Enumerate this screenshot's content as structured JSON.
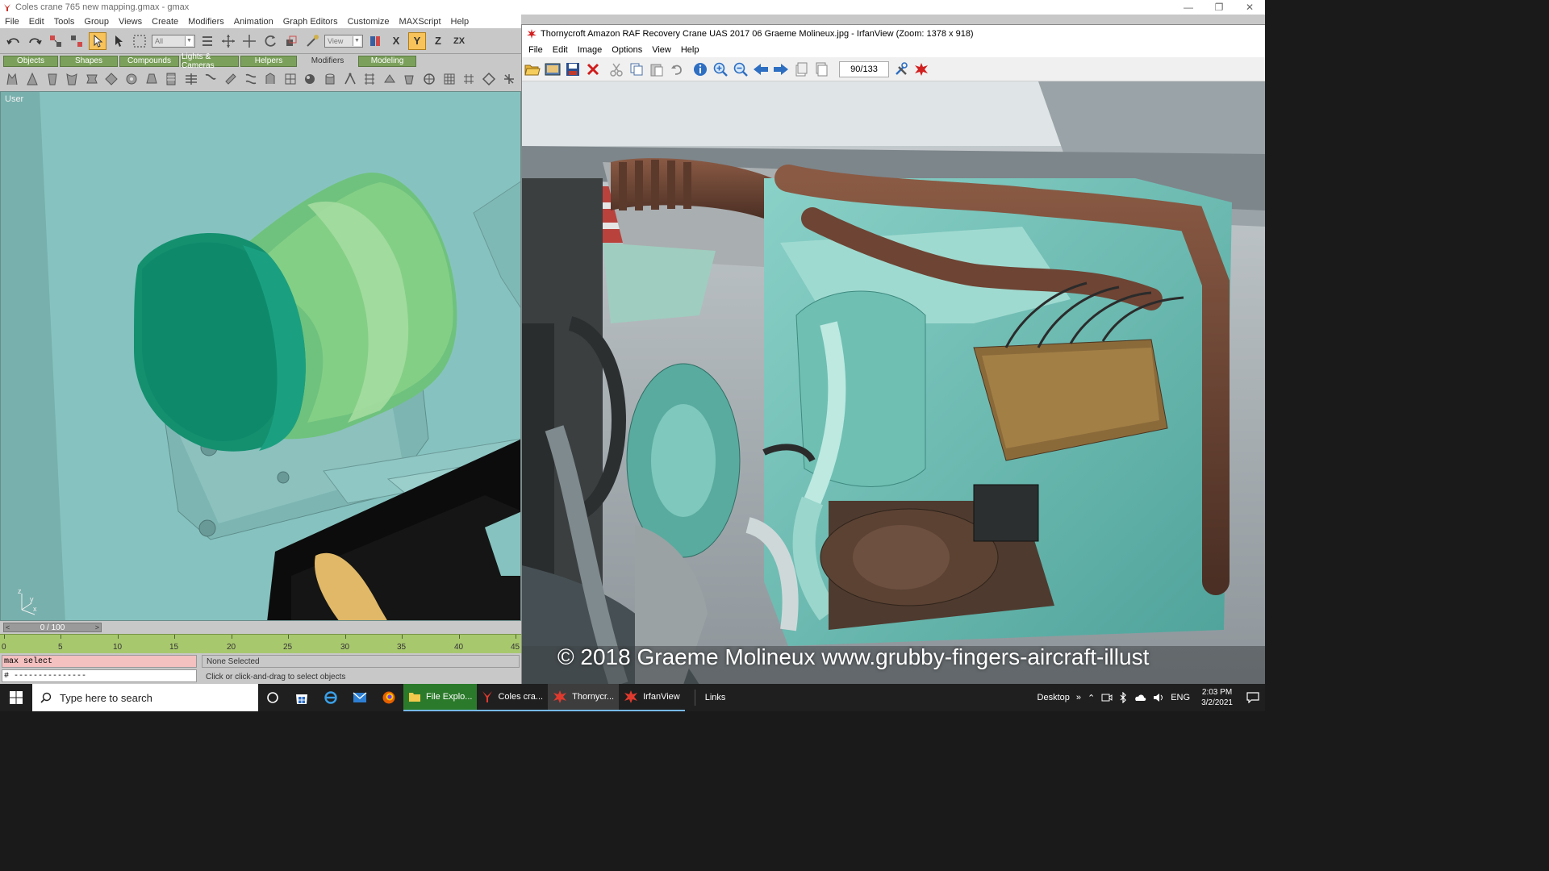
{
  "gmax": {
    "title": "Coles crane 765 new mapping.gmax - gmax",
    "menu": [
      "File",
      "Edit",
      "Tools",
      "Group",
      "Views",
      "Create",
      "Modifiers",
      "Animation",
      "Graph Editors",
      "Customize",
      "MAXScript",
      "Help"
    ],
    "toolbar": {
      "selection_filter": "All",
      "reference_coord": "View",
      "axis_constraints": [
        "X",
        "Y",
        "Z",
        "ZX"
      ]
    },
    "tabs": [
      "Objects",
      "Shapes",
      "Compounds",
      "Lights & Cameras",
      "Helpers",
      "Modifiers",
      "Modeling"
    ],
    "selected_tab": "Modifiers",
    "viewport_label": "User",
    "axis_labels": {
      "z": "z",
      "x": "x",
      "y": "y"
    },
    "time_slider": "0 / 100",
    "timeline_ticks": [
      "0",
      "5",
      "10",
      "15",
      "20",
      "25",
      "30",
      "35",
      "40",
      "45"
    ],
    "maxscript_line1": "max select",
    "maxscript_line2": "# ---------------",
    "status": "None Selected",
    "prompt": "Click or click-and-drag to select objects",
    "colors": {
      "viewport_bg": "#86c3c0",
      "track": "#a8c86e",
      "active_tool": "#f7c35a"
    }
  },
  "irfan": {
    "title": "Thornycroft Amazon RAF Recovery Crane UAS 2017 06 Graeme Molineux.jpg - IrfanView (Zoom: 1378 x 918)",
    "menu": [
      "File",
      "Edit",
      "Image",
      "Options",
      "View",
      "Help"
    ],
    "page_counter": "90/133",
    "watermark": "© 2018 Graeme Molineux www.grubby-fingers-aircraft-illust"
  },
  "taskbar": {
    "search_placeholder": "Type here to search",
    "buttons": [
      {
        "label": "File Explo...",
        "active": false
      },
      {
        "label": "Coles cra...",
        "active": false
      },
      {
        "label": "Thornycr...",
        "active": true
      },
      {
        "label": "IrfanView",
        "active": false
      }
    ],
    "links": "Links",
    "desktop": "Desktop",
    "lang": "ENG",
    "time": "2:03 PM",
    "date": "3/2/2021"
  }
}
